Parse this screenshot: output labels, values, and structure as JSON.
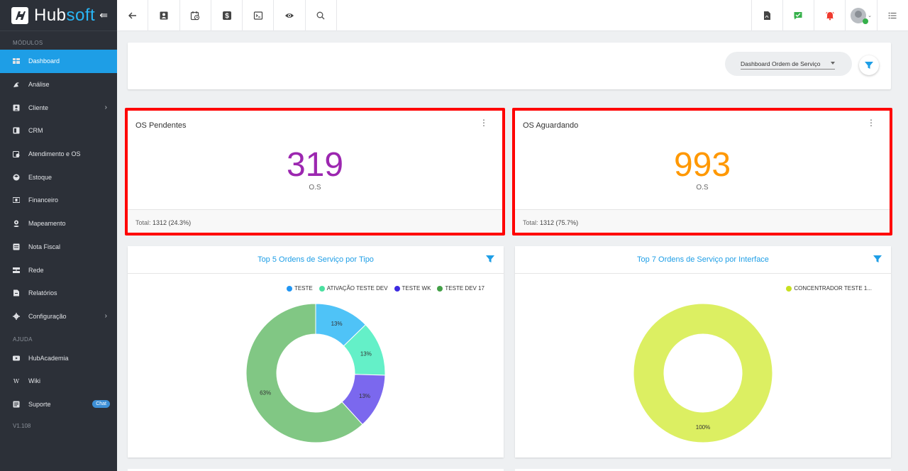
{
  "brand": {
    "name_main": "Hub",
    "name_accent": "soft",
    "collapse_icon": "arrow-collapse-icon"
  },
  "sidebar": {
    "sections": {
      "modules": "MÓDULOS",
      "help": "AJUDA"
    },
    "items": [
      {
        "label": "Dashboard",
        "icon": "dashboard-icon",
        "active": true
      },
      {
        "label": "Análise",
        "icon": "analysis-icon"
      },
      {
        "label": "Cliente",
        "icon": "client-icon",
        "has_children": true
      },
      {
        "label": "CRM",
        "icon": "crm-icon"
      },
      {
        "label": "Atendimento e OS",
        "icon": "calendar-icon"
      },
      {
        "label": "Estoque",
        "icon": "box-icon"
      },
      {
        "label": "Financeiro",
        "icon": "money-icon"
      },
      {
        "label": "Mapeamento",
        "icon": "map-pin-icon"
      },
      {
        "label": "Nota Fiscal",
        "icon": "invoice-icon"
      },
      {
        "label": "Rede",
        "icon": "network-icon"
      },
      {
        "label": "Relatórios",
        "icon": "report-icon"
      },
      {
        "label": "Configuração",
        "icon": "gear-icon",
        "has_children": true
      }
    ],
    "help_items": [
      {
        "label": "HubAcademia",
        "icon": "video-icon"
      },
      {
        "label": "Wiki",
        "icon": "wiki-icon"
      },
      {
        "label": "Suporte",
        "icon": "support-icon",
        "badge": "Chat"
      }
    ],
    "version": "V1.108"
  },
  "topbar": {
    "left_icons": [
      "back-arrow-icon",
      "contact-card-icon",
      "calendar-clock-icon",
      "dollar-icon",
      "terminal-icon",
      "eye-icon",
      "search-icon"
    ],
    "right_icons": [
      "pdf-icon",
      "message-check-icon",
      "alarm-bell-icon",
      "user-avatar-icon",
      "list-menu-icon"
    ]
  },
  "filter_bar": {
    "dashboard_select": "Dashboard Ordem de Serviço"
  },
  "stats": [
    {
      "title": "OS Pendentes",
      "value": "319",
      "unit": "O.S",
      "footer_label": "Total:",
      "footer_value": "1312 (24.3%)",
      "color": "#9c27b0"
    },
    {
      "title": "OS Aguardando",
      "value": "993",
      "unit": "O.S",
      "footer_label": "Total:",
      "footer_value": "1312 (75.7%)",
      "color": "#ff9800"
    }
  ],
  "charts": [
    {
      "title": "Top 5 Ordens de Serviço por Tipo",
      "chart_data": {
        "type": "pie",
        "categories": [
          "TESTE",
          "ATIVAÇÃO TESTE DEV",
          "TESTE WK",
          "TESTE DEV 17"
        ],
        "values": [
          13,
          13,
          13,
          63
        ],
        "labels": [
          "13%",
          "13%",
          "13%",
          "63%"
        ],
        "colors": [
          "#4fc3f7",
          "#64f0c8",
          "#7b68ee",
          "#81c784"
        ],
        "legend_colors": [
          "#2196f3",
          "#4be0a0",
          "#3d2be0",
          "#43a047"
        ],
        "legend": "top-right"
      }
    },
    {
      "title": "Top 7 Ordens de Serviço por Interface",
      "chart_data": {
        "type": "pie",
        "categories": [
          "CONCENTRADOR TESTE 1..."
        ],
        "values": [
          100
        ],
        "labels": [
          "100%"
        ],
        "colors": [
          "#dcef62"
        ],
        "legend_colors": [
          "#c8e020"
        ],
        "legend": "top-right"
      }
    }
  ]
}
